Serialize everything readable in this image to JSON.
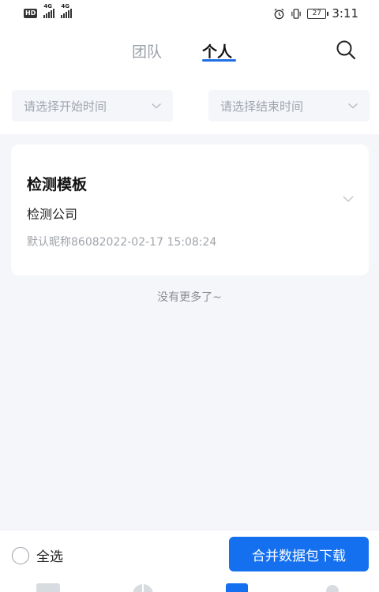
{
  "status_bar": {
    "hd": "HD",
    "network1": "4G",
    "network2": "4G",
    "battery": "27",
    "time": "3:11"
  },
  "header": {
    "tabs": [
      {
        "label": "团队",
        "active": false
      },
      {
        "label": "个人",
        "active": true
      }
    ],
    "search_icon": "search-icon"
  },
  "filters": {
    "start_placeholder": "请选择开始时间",
    "end_placeholder": "请选择结束时间"
  },
  "records": [
    {
      "title": "检测模板",
      "company": "检测公司",
      "meta": "默认昵称86082022-02-17 15:08:24"
    }
  ],
  "list_end_text": "没有更多了~",
  "bottom": {
    "select_all_label": "全选",
    "download_label": "合并数据包下载"
  },
  "colors": {
    "accent": "#1570ef",
    "background": "#f5f6fa",
    "tab_underline": "#1f6fe5"
  }
}
